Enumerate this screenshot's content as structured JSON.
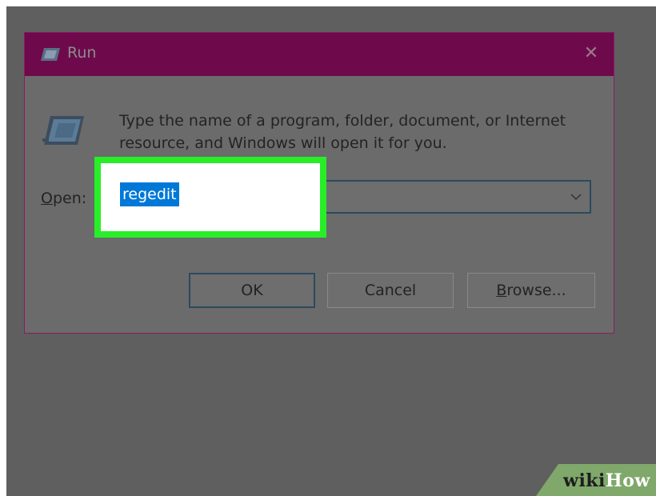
{
  "window": {
    "title": "Run",
    "close_glyph": "✕",
    "title_icon": "run-icon",
    "close_icon": "close-icon"
  },
  "dialog": {
    "description_line1": "Type the name of a program, folder, document, or Internet",
    "description_line2": "resource, and Windows will open it for you.",
    "program_icon": "program-window-icon"
  },
  "open_field": {
    "label_underlined": "O",
    "label_rest": "pen:",
    "value": "regedit",
    "dropdown_glyph": "⌄",
    "dropdown_icon": "chevron-down-icon"
  },
  "buttons": {
    "ok": "OK",
    "cancel": "Cancel",
    "browse_underlined": "B",
    "browse_rest": "rowse..."
  },
  "colors": {
    "titlebar": "#6e0a4c",
    "highlight": "#27ee27",
    "selection": "#0078d7",
    "overlay": "#5f5f5f"
  },
  "watermark": {
    "wiki": "wiki",
    "how": "How"
  }
}
